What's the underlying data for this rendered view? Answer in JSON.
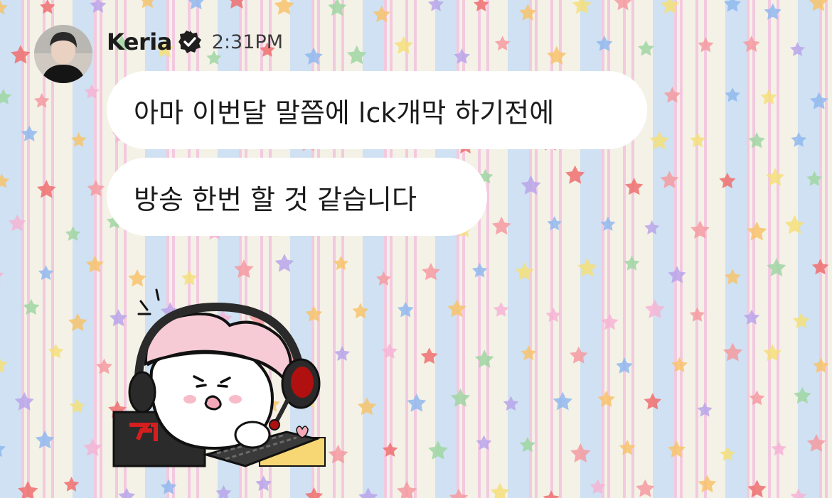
{
  "message": {
    "sender": {
      "name": "Keria",
      "verified": true,
      "avatar": "user-photo"
    },
    "time": "2:31PM",
    "bubbles": [
      {
        "text": "아마 이번달 말쯤에 lck개막 하기전에"
      },
      {
        "text": "방송 한번 할 것 같습니다"
      }
    ],
    "sticker": {
      "description": "mascot-with-headset-at-laptop",
      "laptop_logo": "T1"
    }
  },
  "colors": {
    "bubble": "#ffffff",
    "stripe_blue": "#cfe1f2",
    "stripe_pink": "#f3c9e0",
    "stripe_cream": "#f4f1e6",
    "text": "#1b1b1b",
    "accent_red": "#c41e1e"
  }
}
